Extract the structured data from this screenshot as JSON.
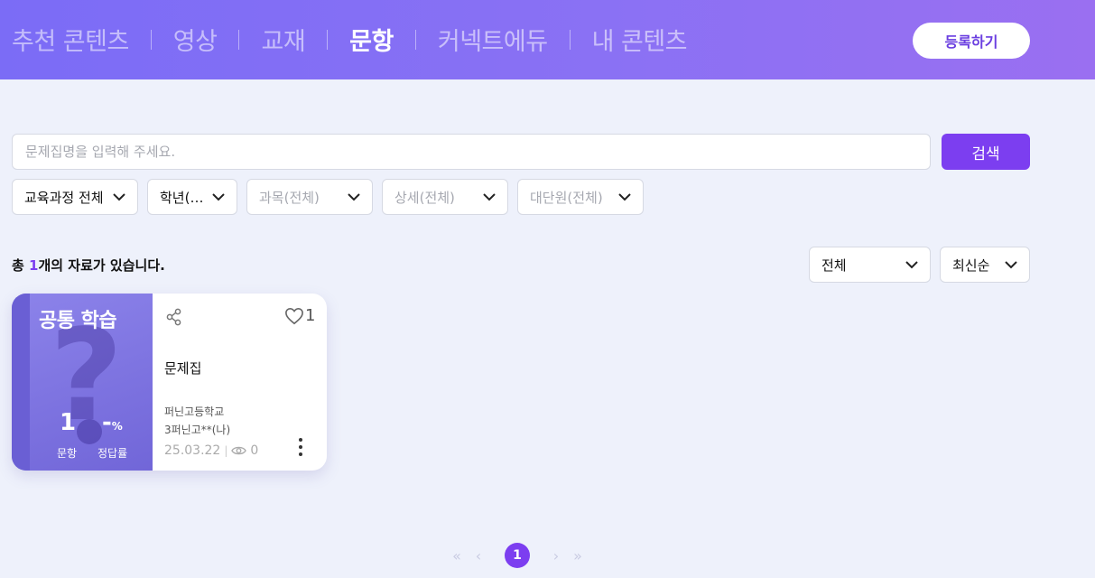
{
  "header": {
    "nav": [
      {
        "label": "추천 콘텐츠",
        "active": false
      },
      {
        "label": "영상",
        "active": false
      },
      {
        "label": "교재",
        "active": false
      },
      {
        "label": "문항",
        "active": true
      },
      {
        "label": "커넥트에듀",
        "active": false
      },
      {
        "label": "내 콘텐츠",
        "active": false
      }
    ],
    "register_label": "등록하기"
  },
  "search": {
    "placeholder": "문제집명을 입력해 주세요.",
    "value": "",
    "button_label": "검색"
  },
  "filters": {
    "curriculum": "교육과정 전체",
    "grade": "학년(…",
    "subject": "과목(전체)",
    "detail": "상세(전체)",
    "unit": "대단원(전체)"
  },
  "results": {
    "prefix": "총 ",
    "count": "1",
    "suffix": "개의 자료가 있습니다.",
    "scope_filter": "전체",
    "sort": "최신순"
  },
  "card": {
    "cover_title": "공통 학습",
    "question_count": "1",
    "question_label": "문항",
    "accuracy_value": "-",
    "accuracy_unit": "%",
    "accuracy_label": "정답률",
    "likes": "1",
    "title": "문제집",
    "school": "퍼닌고등학교",
    "class_name": "3퍼닌고**(나)",
    "date": "25.03.22",
    "views": "0"
  },
  "pagination": {
    "current": "1",
    "first": "«",
    "prev": "‹",
    "next": "›",
    "last": "»"
  },
  "colors": {
    "accent": "#7c3ef0",
    "header_start": "#7b6cf6",
    "header_end": "#9a6ff1",
    "background": "#eef1fb"
  }
}
